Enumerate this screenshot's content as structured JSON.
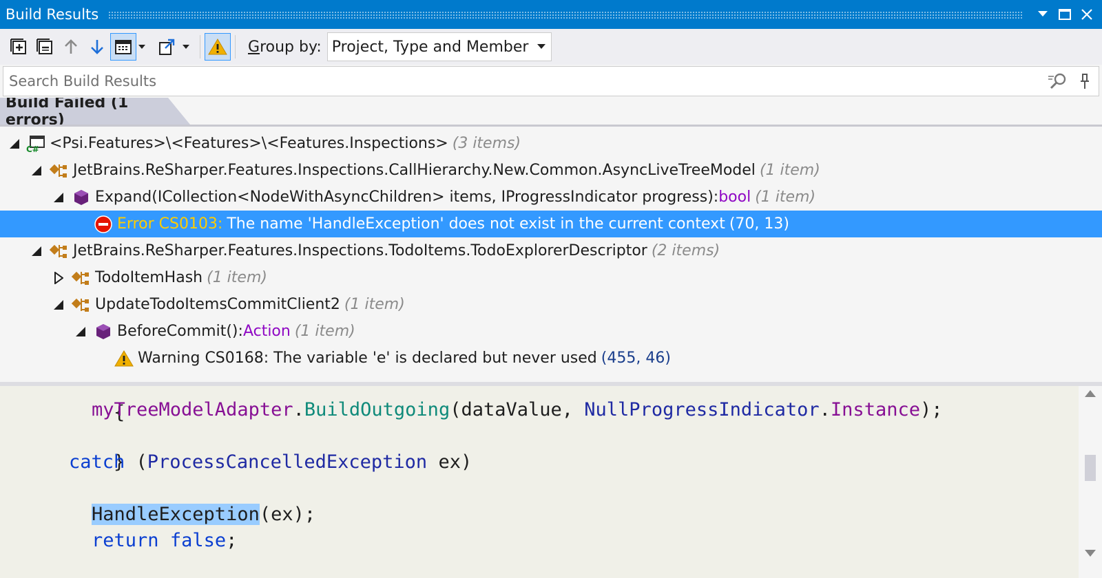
{
  "window": {
    "title": "Build Results"
  },
  "toolbar": {
    "group_by_label_prefix": "G",
    "group_by_label_rest": "roup by:",
    "group_by_value": "Project, Type and Member"
  },
  "search": {
    "placeholder": "Search Build Results"
  },
  "status": {
    "label": "Build Failed (1 errors)"
  },
  "tree": {
    "project": {
      "label": "<Psi.Features>\\<Features>\\<Features.Inspections>",
      "count": "(3 items)"
    },
    "type1": {
      "label": "JetBrains.ReSharper.Features.Inspections.CallHierarchy.New.Common.AsyncLiveTreeModel",
      "count": "(1 item)"
    },
    "member1": {
      "label": "Expand(ICollection<NodeWithAsyncChildren> items, IProgressIndicator progress):",
      "return_type": "bool",
      "count": "(1 item)"
    },
    "error1": {
      "code": "Error CS0103:",
      "message": "The name 'HandleException' does not exist in the current context",
      "location": "(70, 13)"
    },
    "type2": {
      "label": "JetBrains.ReSharper.Features.Inspections.TodoItems.TodoExplorerDescriptor",
      "count": "(2 items)"
    },
    "type2a": {
      "label": "TodoItemHash",
      "count": "(1 item)"
    },
    "type2b": {
      "label": "UpdateTodoItemsCommitClient2",
      "count": "(1 item)"
    },
    "member2": {
      "label": "BeforeCommit():",
      "return_type": "Action",
      "count": "(1 item)"
    },
    "warning1": {
      "message": "Warning CS0168: The variable 'e' is declared but never used",
      "location": "(455, 46)"
    }
  },
  "code": {
    "line1": {
      "brace": "{"
    },
    "line2": {
      "field": "myTreeModelAdapter",
      "dot1": ".",
      "method": "BuildOutgoing",
      "args_open": "(dataValue, ",
      "type": "NullProgressIndicator",
      "dot2": ".",
      "prop": "Instance",
      "tail": ");"
    },
    "line3": {
      "brace": "}"
    },
    "line4": {
      "kw": "catch",
      "open": " (",
      "type": "ProcessCancelledException",
      "tail": " ex)"
    },
    "line5": {
      "brace": "{"
    },
    "line6": {
      "call": "HandleException",
      "tail": "(ex);"
    },
    "line7": {
      "kw1": "return",
      "sp": " ",
      "kw2": "false",
      "tail": ";"
    },
    "line8": {
      "brace": "}"
    }
  },
  "colors": {
    "titlebar": "#007acc",
    "selection": "#3399ff",
    "member_icon": "#68217a",
    "type_icon": "#c27d1a",
    "error_icon": "#e51400",
    "warning_icon": "#f0b000"
  }
}
